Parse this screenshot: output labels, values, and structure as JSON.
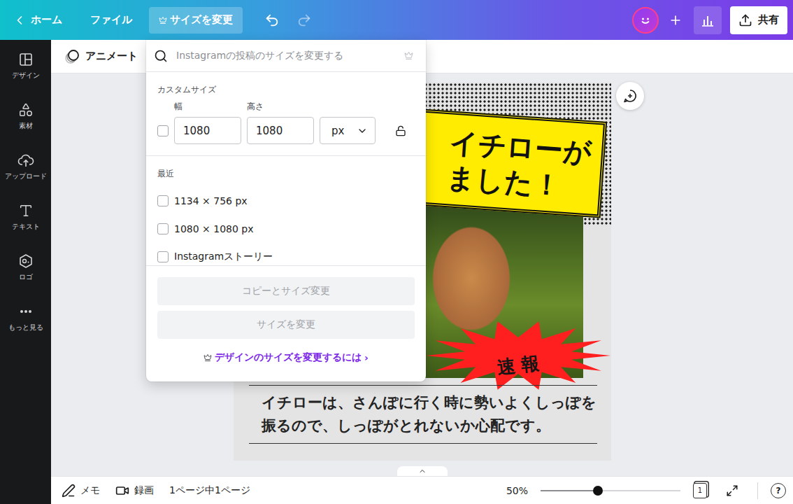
{
  "topbar": {
    "home": "ホーム",
    "file": "ファイル",
    "resize": "サイズを変更",
    "share": "共有"
  },
  "sidebar": {
    "items": [
      {
        "label": "デザイン"
      },
      {
        "label": "素材"
      },
      {
        "label": "アップロード"
      },
      {
        "label": "テキスト"
      },
      {
        "label": "ロゴ"
      },
      {
        "label": "もっと見る"
      }
    ]
  },
  "toolbar": {
    "animate": "アニメート"
  },
  "design": {
    "headline": [
      "イチローが",
      "ました！"
    ],
    "badge": "速報",
    "caption": [
      "イチローは、さんぽに行く時に勢いよくしっぽを",
      "振るので、しっぽがとれないか心配です。"
    ]
  },
  "resize_menu": {
    "search_placeholder": "Instagramの投稿のサイズを変更する",
    "custom_title": "カスタムサイズ",
    "width_label": "幅",
    "height_label": "高さ",
    "width": "1080",
    "height": "1080",
    "unit": "px",
    "custom_checked": false,
    "locked": false,
    "recent_title": "最近",
    "recent": [
      {
        "label": "1134 × 756 px",
        "checked": false
      },
      {
        "label": "1080 × 1080 px",
        "checked": false
      },
      {
        "label": "Instagramストーリー",
        "checked": false
      }
    ],
    "buttons": [
      {
        "label": "コピーとサイズ変更",
        "disabled": true
      },
      {
        "label": "サイズを変更",
        "disabled": true
      }
    ],
    "help_link": "デザインのサイズを変更するには",
    "help_chevron": "›"
  },
  "bottombar": {
    "notes": "メモ",
    "record": "録画",
    "pages": "1ページ中1ページ",
    "zoom": "50%",
    "zoom_level": 0.41,
    "page_count": "1",
    "help": "?"
  }
}
